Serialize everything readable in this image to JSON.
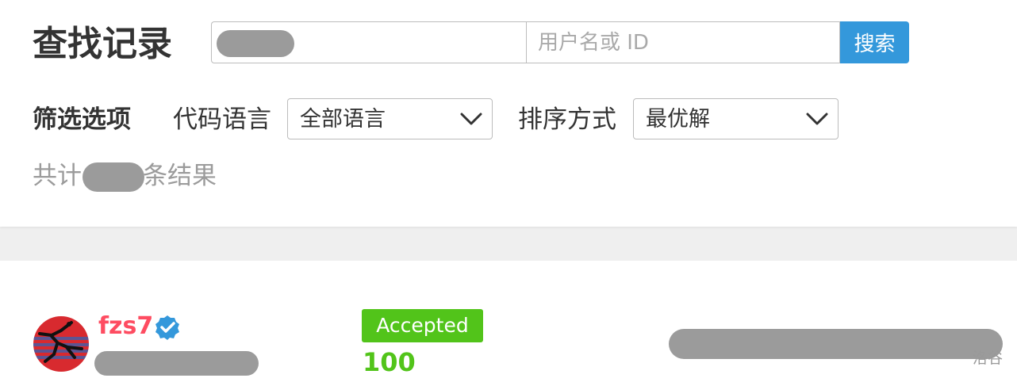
{
  "header": {
    "title": "查找记录",
    "problem_input": {
      "value": ""
    },
    "user_input": {
      "placeholder": "用户名或 ID"
    },
    "search_button": "搜索"
  },
  "filters": {
    "heading": "筛选选项",
    "language": {
      "label": "代码语言",
      "selected": "全部语言"
    },
    "sort": {
      "label": "排序方式",
      "selected": "最优解"
    }
  },
  "results": {
    "prefix": "共计",
    "suffix": "条结果"
  },
  "record": {
    "username": "fzs7",
    "status": "Accepted",
    "score": "100",
    "watermark": "洛谷"
  },
  "colors": {
    "accent_blue": "#3498db",
    "username_red": "#fe4c61",
    "accepted_green": "#52c41a",
    "redaction_gray": "#9b9b9b"
  },
  "icons": {
    "dropdown": "chevron-down-icon",
    "verified": "verified-badge-icon",
    "avatar": "avatar-image"
  }
}
